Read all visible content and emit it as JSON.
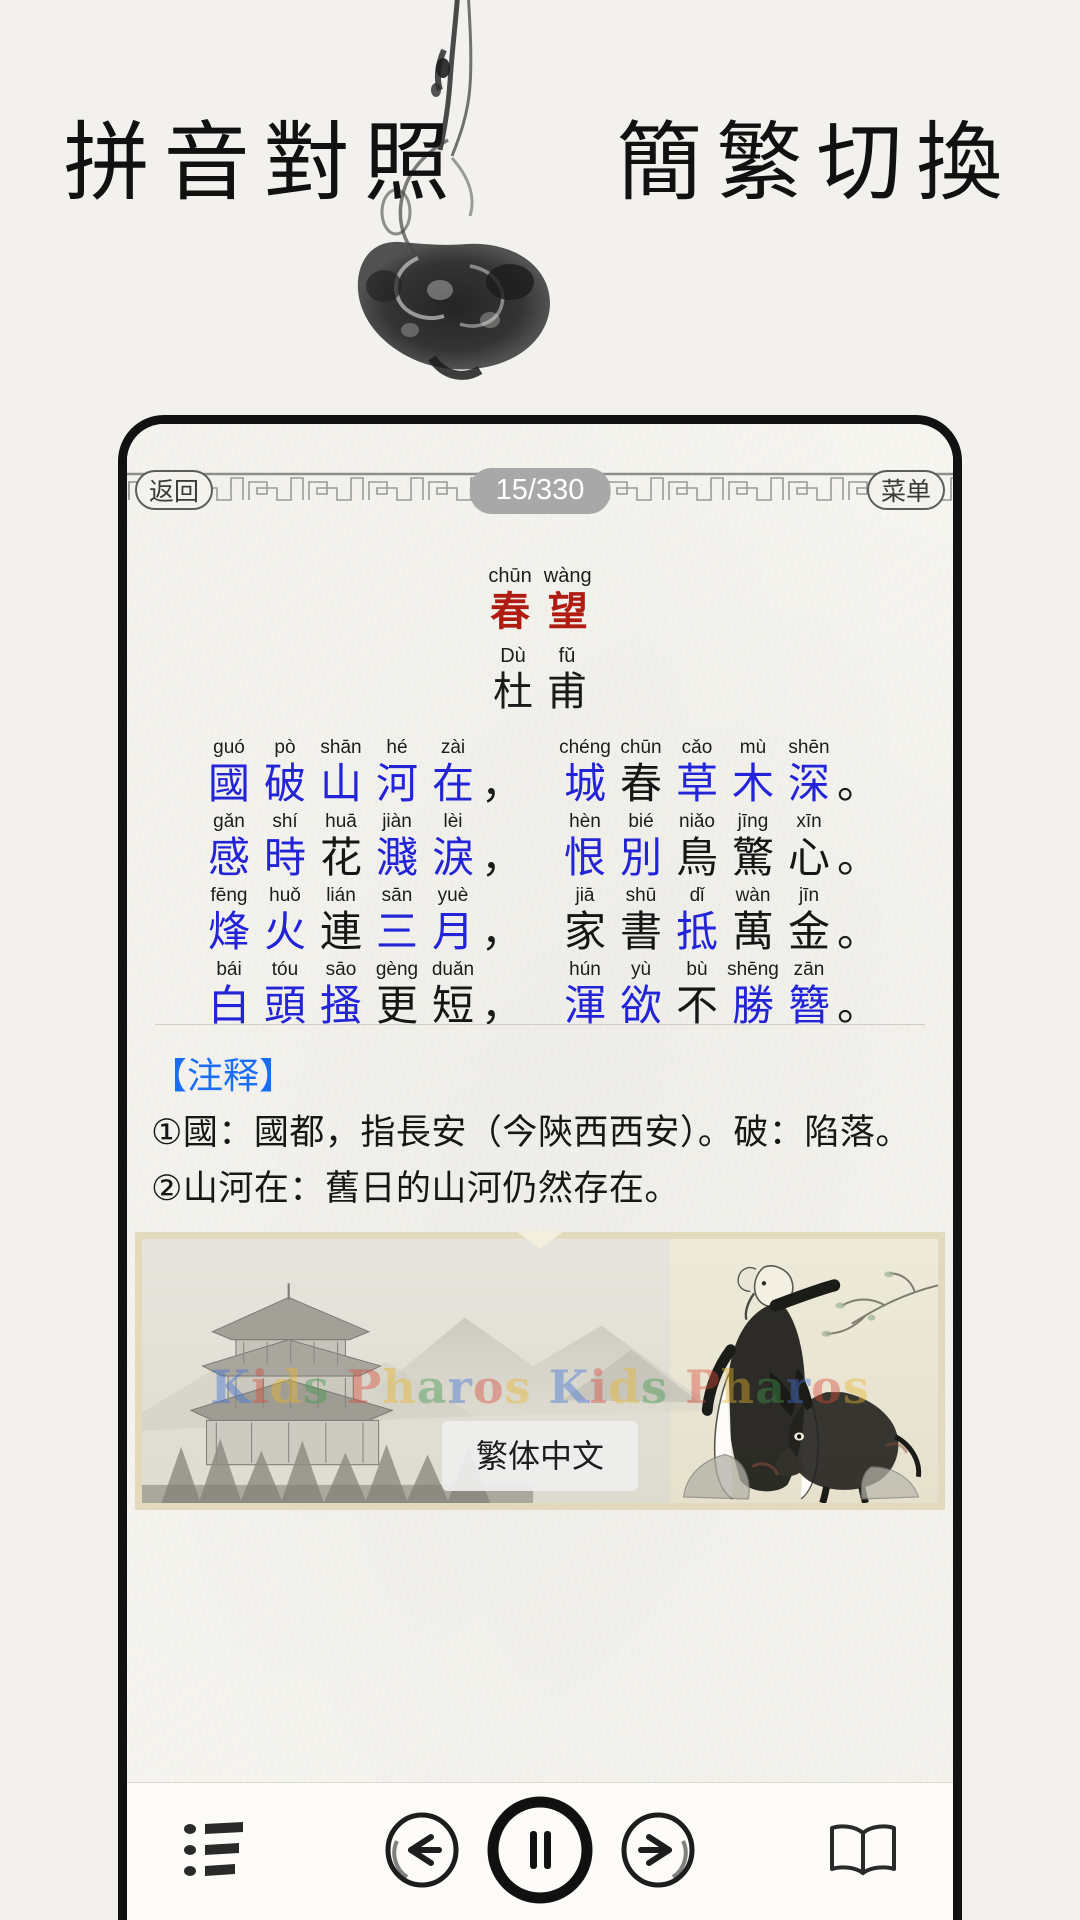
{
  "promo": {
    "headline_left": "拼音對照",
    "headline_right": "簡繁切換"
  },
  "app": {
    "topbar": {
      "back_label": "返回",
      "menu_label": "菜单",
      "page_counter": "15/330"
    },
    "poem": {
      "title_chars": [
        {
          "py": "chūn",
          "hz": "春"
        },
        {
          "py": "wàng",
          "hz": "望"
        }
      ],
      "author_chars": [
        {
          "py": "Dù",
          "hz": "杜"
        },
        {
          "py": "fǔ",
          "hz": "甫"
        }
      ],
      "lines": [
        {
          "left": [
            {
              "py": "guó",
              "hz": "國",
              "color": "blue"
            },
            {
              "py": "pò",
              "hz": "破",
              "color": "blue"
            },
            {
              "py": "shān",
              "hz": "山",
              "color": "blue"
            },
            {
              "py": "hé",
              "hz": "河",
              "color": "blue"
            },
            {
              "py": "zài",
              "hz": "在",
              "color": "blue"
            }
          ],
          "mid_punct": "，",
          "right": [
            {
              "py": "chéng",
              "hz": "城",
              "color": "blue"
            },
            {
              "py": "chūn",
              "hz": "春",
              "color": "black"
            },
            {
              "py": "cǎo",
              "hz": "草",
              "color": "blue"
            },
            {
              "py": "mù",
              "hz": "木",
              "color": "blue"
            },
            {
              "py": "shēn",
              "hz": "深",
              "color": "blue"
            }
          ],
          "end_punct": "。"
        },
        {
          "left": [
            {
              "py": "gǎn",
              "hz": "感",
              "color": "blue"
            },
            {
              "py": "shí",
              "hz": "時",
              "color": "blue"
            },
            {
              "py": "huā",
              "hz": "花",
              "color": "black"
            },
            {
              "py": "jiàn",
              "hz": "濺",
              "color": "blue"
            },
            {
              "py": "lèi",
              "hz": "淚",
              "color": "blue"
            }
          ],
          "mid_punct": "，",
          "right": [
            {
              "py": "hèn",
              "hz": "恨",
              "color": "blue"
            },
            {
              "py": "bié",
              "hz": "別",
              "color": "blue"
            },
            {
              "py": "niǎo",
              "hz": "鳥",
              "color": "black"
            },
            {
              "py": "jīng",
              "hz": "驚",
              "color": "black"
            },
            {
              "py": "xīn",
              "hz": "心",
              "color": "black"
            }
          ],
          "end_punct": "。"
        },
        {
          "left": [
            {
              "py": "fēng",
              "hz": "烽",
              "color": "blue"
            },
            {
              "py": "huǒ",
              "hz": "火",
              "color": "blue"
            },
            {
              "py": "lián",
              "hz": "連",
              "color": "black"
            },
            {
              "py": "sān",
              "hz": "三",
              "color": "blue"
            },
            {
              "py": "yuè",
              "hz": "月",
              "color": "blue"
            }
          ],
          "mid_punct": "，",
          "right": [
            {
              "py": "jiā",
              "hz": "家",
              "color": "black"
            },
            {
              "py": "shū",
              "hz": "書",
              "color": "black"
            },
            {
              "py": "dǐ",
              "hz": "抵",
              "color": "blue"
            },
            {
              "py": "wàn",
              "hz": "萬",
              "color": "black"
            },
            {
              "py": "jīn",
              "hz": "金",
              "color": "black"
            }
          ],
          "end_punct": "。"
        },
        {
          "left": [
            {
              "py": "bái",
              "hz": "白",
              "color": "blue"
            },
            {
              "py": "tóu",
              "hz": "頭",
              "color": "blue"
            },
            {
              "py": "sāo",
              "hz": "搔",
              "color": "blue"
            },
            {
              "py": "gèng",
              "hz": "更",
              "color": "black"
            },
            {
              "py": "duǎn",
              "hz": "短",
              "color": "black"
            }
          ],
          "mid_punct": "，",
          "right": [
            {
              "py": "hún",
              "hz": "渾",
              "color": "blue"
            },
            {
              "py": "yù",
              "hz": "欲",
              "color": "blue"
            },
            {
              "py": "bù",
              "hz": "不",
              "color": "black"
            },
            {
              "py": "shēng",
              "hz": "勝",
              "color": "blue"
            },
            {
              "py": "zān",
              "hz": "簪",
              "color": "blue"
            }
          ],
          "end_punct": "。"
        }
      ]
    },
    "notes": {
      "heading": "【注释】",
      "items": [
        "①國：國都，指長安（今陝西西安）。破：陷落。",
        "②山河在：舊日的山河仍然存在。"
      ]
    },
    "illustration": {
      "watermark": "Kids Pharos Kids Pharos",
      "lang_chip": "繁体中文"
    },
    "toolbar": {
      "list_icon": "list-icon",
      "prev_icon": "arrow-left-icon",
      "play_icon": "pause-icon",
      "next_icon": "arrow-right-icon",
      "book_icon": "book-icon"
    }
  },
  "colors": {
    "blue": "#2323d8",
    "black": "#161616",
    "title_red": "#b01c12",
    "notes_blue": "#1a6ef5",
    "counter_bg": "#a8a8a8"
  }
}
